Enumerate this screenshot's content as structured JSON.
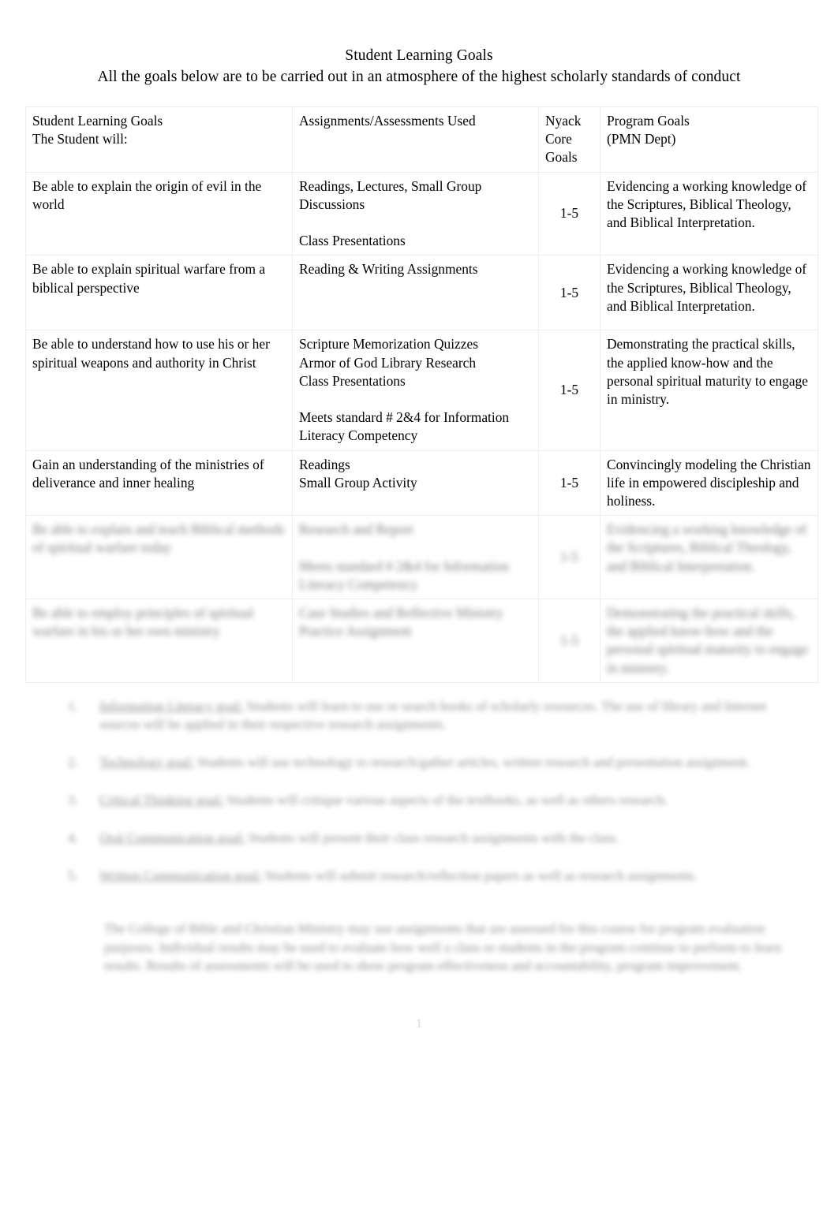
{
  "document": {
    "title": "Student Learning Goals",
    "subtitle": "All the goals below are to be carried out in an atmosphere of the highest scholarly standards of conduct",
    "page_number": "1"
  },
  "table": {
    "headers": {
      "col1_line1": "Student Learning Goals",
      "col1_line2": "The Student will:",
      "col2_line1": "Assignments/Assessments Used",
      "col3_line1": "Nyack",
      "col3_line2": "Core",
      "col3_line3": "Goals",
      "col4_line1": "Program Goals",
      "col4_line2": "(PMN Dept)"
    },
    "rows": [
      {
        "goal": "Be able to explain the origin of evil in the world",
        "assignments_line1": "Readings, Lectures, Small Group",
        "assignments_line2": "Discussions",
        "assignments_line3": "Class Presentations",
        "assignments_line4": "",
        "assignments_line5": "",
        "core_goals": "1-5",
        "program_goals": "Evidencing a working knowledge of the Scriptures, Biblical Theology, and Biblical Interpretation."
      },
      {
        "goal": "Be able to explain spiritual warfare from a biblical perspective",
        "assignments_line1": "Reading & Writing Assignments",
        "assignments_line2": "",
        "assignments_line3": "",
        "assignments_line4": "",
        "assignments_line5": "",
        "core_goals": "1-5",
        "program_goals": "Evidencing a working knowledge of the Scriptures, Biblical Theology, and Biblical Interpretation."
      },
      {
        "goal": "Be able to understand how to use his or her spiritual weapons and authority in Christ",
        "assignments_line1": "Scripture Memorization Quizzes",
        "assignments_line2": "Armor of God Library Research",
        "assignments_line3": "Class Presentations",
        "assignments_line4": "Meets standard # 2&4 for Information",
        "assignments_line5": "Literacy Competency",
        "core_goals": "1-5",
        "program_goals": "Demonstrating the practical skills, the applied know-how and the personal spiritual maturity to engage in ministry."
      },
      {
        "goal": "Gain an understanding of the ministries of deliverance and inner healing",
        "assignments_line1": "Readings",
        "assignments_line2": "Small Group Activity",
        "assignments_line3": "",
        "assignments_line4": "",
        "assignments_line5": "",
        "core_goals": "1-5",
        "program_goals": "Convincingly modeling the Christian life in empowered discipleship and holiness."
      },
      {
        "goal": "Be able to explain and teach Biblical methods of spiritual warfare today",
        "assignments_line1": "Research and Report",
        "assignments_line2": "",
        "assignments_line3": "Meets standard # 2&4 for Information Literacy Competency",
        "assignments_line4": "",
        "assignments_line5": "",
        "core_goals": "1-5",
        "program_goals": "Evidencing a working knowledge of the Scriptures, Biblical Theology, and Biblical Interpretation."
      },
      {
        "goal": "Be able to employ principles of spiritual warfare in his or her own ministry",
        "assignments_line1": "Case Studies and Reflective Ministry",
        "assignments_line2": "Practice Assignment",
        "assignments_line3": "",
        "assignments_line4": "",
        "assignments_line5": "",
        "core_goals": "1-5",
        "program_goals": "Demonstrating the practical skills, the applied know-how and the personal spiritual maturity to engage in ministry."
      }
    ]
  },
  "outcomes": {
    "items": [
      {
        "number": "1.",
        "term": "Information Literacy goal:",
        "text": "Students will learn to use or search books of scholarly resources. The use of library and Internet sources will be applied in their respective research assignments."
      },
      {
        "number": "2.",
        "term": "Technology goal:",
        "text": "Students will use technology to research/gather articles, written research and presentation assignment."
      },
      {
        "number": "3.",
        "term": "Critical Thinking goal:",
        "text": "Students will critique various aspects of the textbooks, as well as others research."
      },
      {
        "number": "4.",
        "term": "Oral Communication goal:",
        "text": "Students will present their class research assignments with the class."
      },
      {
        "number": "5.",
        "term": "Written Communication goal:",
        "text": "Students will submit research/reflection papers as well as research assignments."
      }
    ]
  },
  "closing": {
    "text": "The College of Bible and Christian Ministry may use assignments that are assessed for this course for program evaluation purposes.  Individual results may be used to evaluate how well a class or students in the program continue to perform to learn results.  Results of assessments will be used to show program effectiveness and accountability, program improvement."
  }
}
